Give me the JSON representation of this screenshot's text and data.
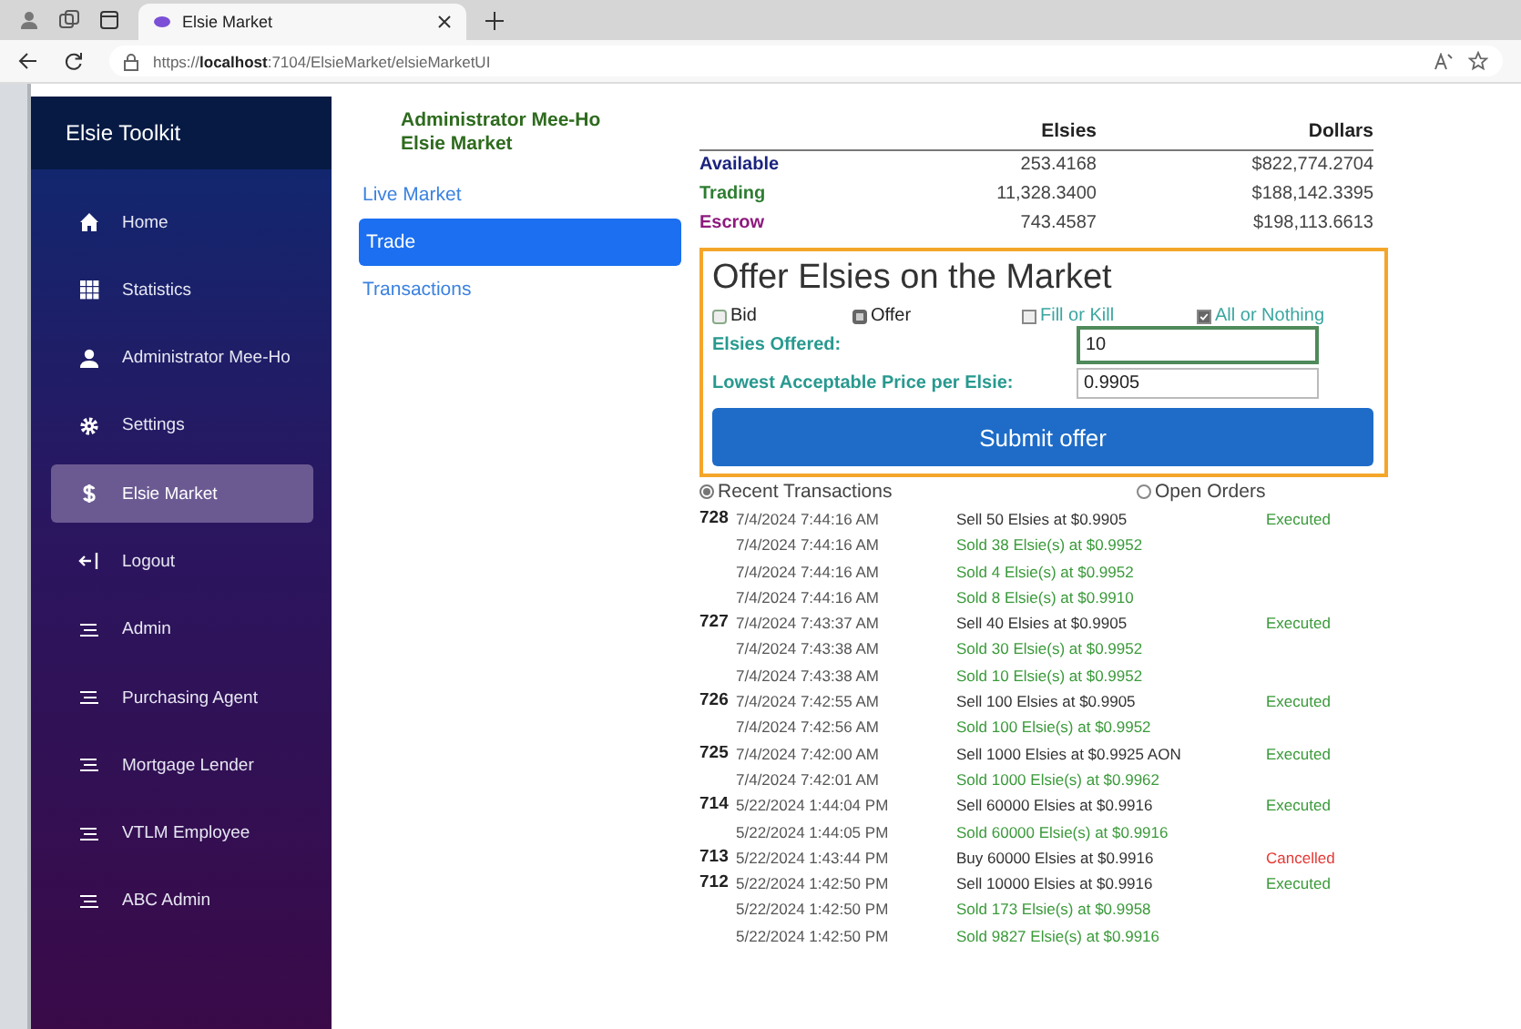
{
  "browser": {
    "tab_title": "Elsie Market",
    "url": "https://**localhost**:7104/ElsieMarket/elsieMarketUI"
  },
  "sidebar": {
    "title": "Elsie Toolkit",
    "items": [
      {
        "label": "Home",
        "kind": "home",
        "selected": false
      },
      {
        "label": "Statistics",
        "kind": "grid",
        "selected": false
      },
      {
        "label": "Administrator Mee-Ho",
        "kind": "person",
        "selected": false
      },
      {
        "label": "Settings",
        "kind": "gear",
        "selected": false
      },
      {
        "label": "Elsie Market",
        "kind": "dollar",
        "selected": true
      },
      {
        "label": "Logout",
        "kind": "logout",
        "selected": false
      },
      {
        "label": "Admin",
        "kind": "list",
        "selected": false
      },
      {
        "label": "Purchasing Agent",
        "kind": "list",
        "selected": false
      },
      {
        "label": "Mortgage Lender",
        "kind": "list",
        "selected": false
      },
      {
        "label": "VTLM Employee",
        "kind": "list",
        "selected": false
      },
      {
        "label": "ABC Admin",
        "kind": "list",
        "selected": false
      }
    ]
  },
  "user_heading": [
    "Administrator Mee-Ho",
    "Elsie Market"
  ],
  "market_nav": [
    {
      "label": "Live Market",
      "selected": false
    },
    {
      "label": "Trade",
      "selected": true
    },
    {
      "label": "Transactions",
      "selected": false
    }
  ],
  "balances": {
    "columns": [
      "Elsies",
      "Dollars"
    ],
    "rows": [
      {
        "label": "Available",
        "color": "#1a237e",
        "elsies": "253.4168",
        "dollars": "$822,774.2704"
      },
      {
        "label": "Trading",
        "color": "#2e7d32",
        "elsies": "11,328.3400",
        "dollars": "$188,142.3395"
      },
      {
        "label": "Escrow",
        "color": "#8e1a7e",
        "elsies": "743.4587",
        "dollars": "$198,113.6613"
      }
    ]
  },
  "offer_form": {
    "title": "Offer Elsies on the Market",
    "options": [
      {
        "label": "Bid",
        "kind": "radio",
        "selected": false
      },
      {
        "label": "Offer",
        "kind": "radio",
        "selected": true
      },
      {
        "label": "Fill or Kill",
        "kind": "checkbox",
        "checked": false
      },
      {
        "label": "All or Nothing",
        "kind": "checkbox",
        "checked": true
      }
    ],
    "fields": [
      {
        "label": "Elsies Offered:",
        "value": "10",
        "focused": true
      },
      {
        "label": "Lowest Acceptable Price per Elsie:",
        "value": "0.9905",
        "focused": false
      }
    ],
    "submit": "Submit offer"
  },
  "view_toggle": [
    {
      "label": "Recent Transactions",
      "selected": true
    },
    {
      "label": "Open Orders",
      "selected": false
    }
  ],
  "transactions": [
    {
      "id": "728",
      "date": "7/4/2024 7:44:16 AM",
      "description": "Sell 50 Elsies at $0.9905",
      "status": "Executed",
      "color": "#3a9a3a",
      "fills": [
        {
          "date": "7/4/2024 7:44:16 AM",
          "description": "Sold 38 Elsie(s) at $0.9952"
        },
        {
          "date": "7/4/2024 7:44:16 AM",
          "description": "Sold 4 Elsie(s) at $0.9952"
        },
        {
          "date": "7/4/2024 7:44:16 AM",
          "description": "Sold 8 Elsie(s) at $0.9910"
        }
      ]
    },
    {
      "id": "727",
      "date": "7/4/2024 7:43:37 AM",
      "description": "Sell 40 Elsies at $0.9905",
      "status": "Executed",
      "color": "#3a9a3a",
      "fills": [
        {
          "date": "7/4/2024 7:43:38 AM",
          "description": "Sold 30 Elsie(s) at $0.9952"
        },
        {
          "date": "7/4/2024 7:43:38 AM",
          "description": "Sold 10 Elsie(s) at $0.9952"
        }
      ]
    },
    {
      "id": "726",
      "date": "7/4/2024 7:42:55 AM",
      "description": "Sell 100 Elsies at $0.9905",
      "status": "Executed",
      "color": "#3a9a3a",
      "fills": [
        {
          "date": "7/4/2024 7:42:56 AM",
          "description": "Sold 100 Elsie(s) at $0.9952"
        }
      ]
    },
    {
      "id": "725",
      "date": "7/4/2024 7:42:00 AM",
      "description": "Sell 1000 Elsies at $0.9925 AON",
      "status": "Executed",
      "color": "#3a9a3a",
      "fills": [
        {
          "date": "7/4/2024 7:42:01 AM",
          "description": "Sold 1000 Elsie(s) at $0.9962"
        }
      ]
    },
    {
      "id": "714",
      "date": "5/22/2024 1:44:04 PM",
      "description": "Sell 60000 Elsies at $0.9916",
      "status": "Executed",
      "color": "#3a9a3a",
      "fills": [
        {
          "date": "5/22/2024 1:44:05 PM",
          "description": "Sold 60000 Elsie(s) at $0.9916"
        }
      ]
    },
    {
      "id": "713",
      "date": "5/22/2024 1:43:44 PM",
      "description": "Buy 60000 Elsies at $0.9916",
      "status": "Cancelled",
      "color": "#e53935"
    },
    {
      "id": "712",
      "date": "5/22/2024 1:42:50 PM",
      "description": "Sell 10000 Elsies at $0.9916",
      "status": "Executed",
      "color": "#3a9a3a",
      "fills": [
        {
          "date": "5/22/2024 1:42:50 PM",
          "description": "Sold 173 Elsie(s) at $0.9958"
        },
        {
          "date": "5/22/2024 1:42:50 PM",
          "description": "Sold 9827 Elsie(s) at $0.9916"
        }
      ]
    }
  ]
}
